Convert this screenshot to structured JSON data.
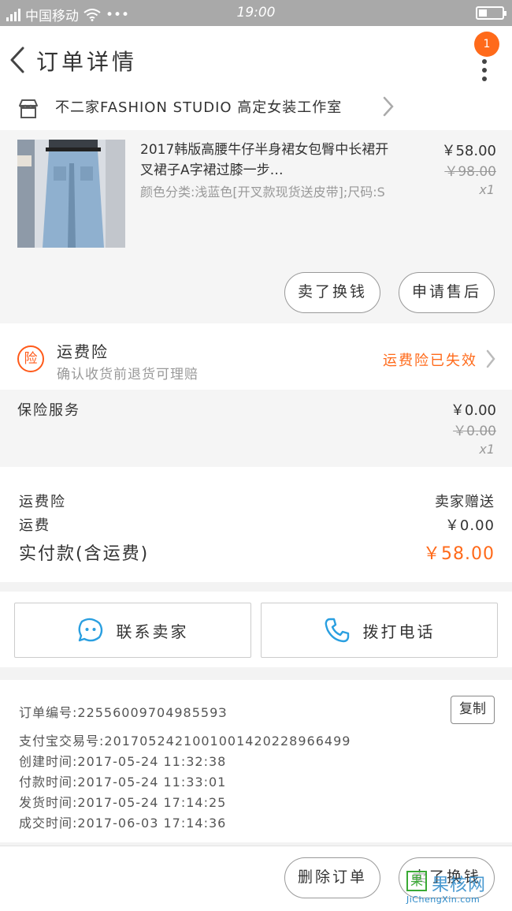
{
  "status_bar": {
    "carrier": "中国移动",
    "dots": "•••",
    "time": "19:00"
  },
  "header": {
    "title": "订单详情",
    "badge": "1"
  },
  "shop": {
    "name": "不二家FASHION STUDIO  高定女装工作室"
  },
  "item": {
    "title": "2017韩版高腰牛仔半身裙女包臀中长裙开叉裙子A字裙过膝一步…",
    "sku": "颜色分类:浅蓝色[开叉款现货送皮带];尺码:S",
    "price": "￥58.00",
    "original_price": "￥98.00",
    "quantity": "x1",
    "button_sell": "卖了换钱",
    "button_aftersale": "申请售后"
  },
  "insurance": {
    "icon_label": "险",
    "title": "运费险",
    "subtitle": "确认收货前退货可理赔",
    "status": "运费险已失效"
  },
  "service": {
    "label": "保险服务",
    "price": "￥0.00",
    "original_price": "￥0.00",
    "quantity": "x1"
  },
  "summary": {
    "insurance_label": "运费险",
    "insurance_value": "卖家赠送",
    "shipping_label": "运费",
    "shipping_value": "￥0.00",
    "total_label": "实付款(含运费)",
    "total_value": "￥58.00"
  },
  "contact": {
    "seller_label": "联系卖家",
    "call_label": "拨打电话"
  },
  "order_info": {
    "order_no": "订单编号:2255600970498559З",
    "alipay_no": "支付宝交易号:2017052421001001420228966499",
    "created": "创建时间:2017-05-24 11:32:38",
    "paid": "付款时间:2017-05-24 11:33:01",
    "shipped": "发货时间:2017-05-24 17:14:25",
    "completed": "成交时间:2017-06-03 17:14:36",
    "copy_label": "复制"
  },
  "bottom": {
    "delete_label": "删除订单",
    "sell_label": "卖了换钱"
  },
  "watermark": {
    "logo_char": "果",
    "text": "果核网",
    "url": "JiChengXin.com"
  },
  "colors": {
    "accent": "#ff6a1a",
    "status_bar": "#a9a9a9"
  }
}
